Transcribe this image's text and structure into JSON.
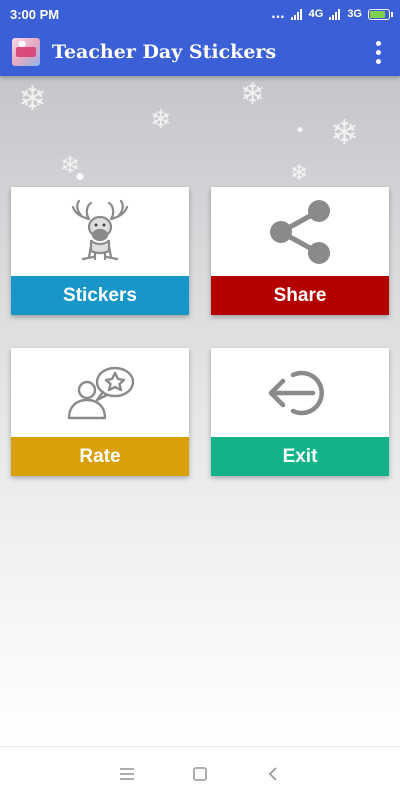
{
  "status_bar": {
    "time": "3:00 PM",
    "dots": "...",
    "network1": "4G",
    "network2": "3G",
    "battery_level": 0.85
  },
  "app_bar": {
    "title": "Teacher Day Stickers",
    "logo_icon": "app-logo-icon",
    "menu_icon": "more-vert-icon"
  },
  "tiles": [
    {
      "label": "Stickers",
      "icon": "reindeer-icon",
      "color": "#1896c8"
    },
    {
      "label": "Share",
      "icon": "share-icon",
      "color": "#b50000"
    },
    {
      "label": "Rate",
      "icon": "rate-icon",
      "color": "#d9a008"
    },
    {
      "label": "Exit",
      "icon": "exit-icon",
      "color": "#12b38a"
    }
  ],
  "nav_bar": {
    "icons": [
      "menu-icon",
      "home-square-icon",
      "back-chevron-icon"
    ]
  },
  "colors": {
    "primary": "#3a5fd6",
    "icon_gray": "#8a8a8a"
  }
}
